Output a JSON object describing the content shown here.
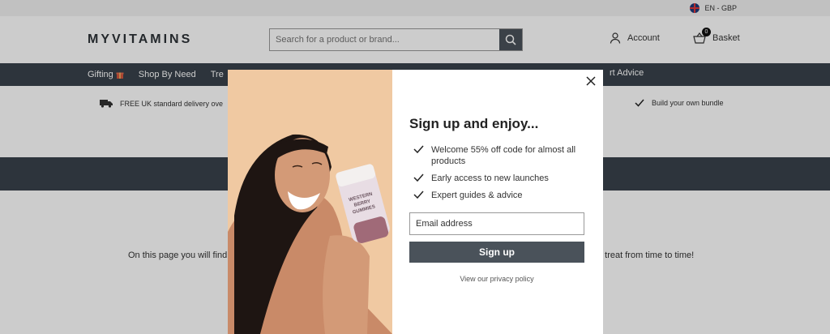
{
  "locale": {
    "label": "EN - GBP",
    "flag_icon": "uk-flag-icon"
  },
  "header": {
    "logo": "MYVITAMINS",
    "search_placeholder": "Search for a product or brand...",
    "account_label": "Account",
    "basket_label": "Basket",
    "basket_count": "0"
  },
  "nav": {
    "items": [
      "Gifting",
      "Shop By Need",
      "Tre"
    ],
    "right_item": "rt Advice"
  },
  "usp": {
    "left": "FREE UK standard delivery ove",
    "right": "Build your own bundle"
  },
  "page": {
    "text_left": "On this page you will find",
    "text_right": "e treat from time to time!"
  },
  "modal": {
    "title": "Sign up and enjoy...",
    "benefits": [
      "Welcome 55% off code for almost all products",
      "Early access to new launches",
      "Expert guides & advice"
    ],
    "email_placeholder": "Email address",
    "signup_label": "Sign up",
    "privacy_label": "View our privacy policy",
    "product_label_line1": "WESTERN",
    "product_label_line2": "BERRY",
    "product_label_line3": "GUMMIES"
  },
  "colors": {
    "nav_bg": "#39424b",
    "button_bg": "#4a525a",
    "image_bg": "#f0c9a2"
  }
}
